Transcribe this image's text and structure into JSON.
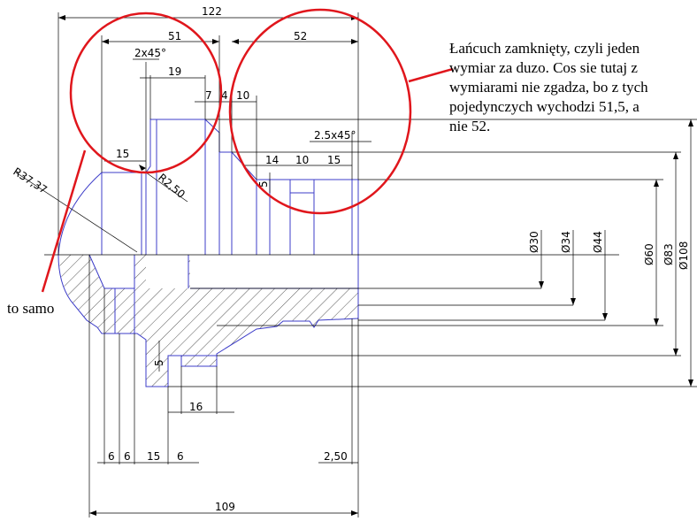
{
  "annotations": {
    "main_note": "Łańcuch zamknięty, czyli jeden\nwymiar za duzo. Cos sie tutaj z\nwymiarami nie zgadza, bo z tych\npojedynczych wychodzi 51,5, a\nnie 52.",
    "side_note": "to samo"
  },
  "dimensions": {
    "d122": "122",
    "d51": "51",
    "d52": "52",
    "chamfer1": "2x45°",
    "d19": "19",
    "d7": "7",
    "d4": "4",
    "d10a": "10",
    "chamfer2": "2.5x45°",
    "d15a": "15",
    "r2": "R2,50",
    "r37": "R37,37",
    "d14": "14",
    "d10b": "10",
    "d15b": "15",
    "d5a": "5",
    "dia30": "Ø30",
    "dia34": "Ø34",
    "dia44": "Ø44",
    "dia60": "Ø60",
    "dia83": "Ø83",
    "dia108": "Ø108",
    "d5b": "5",
    "d16": "16",
    "d6a": "6",
    "d6b": "6",
    "d15c": "15",
    "d6c": "6",
    "d250": "2,50",
    "d109": "109"
  },
  "colors": {
    "outline": "#3c3cc8",
    "dimension": "#000000",
    "markup": "#e0161c",
    "hatch": "#333333"
  }
}
